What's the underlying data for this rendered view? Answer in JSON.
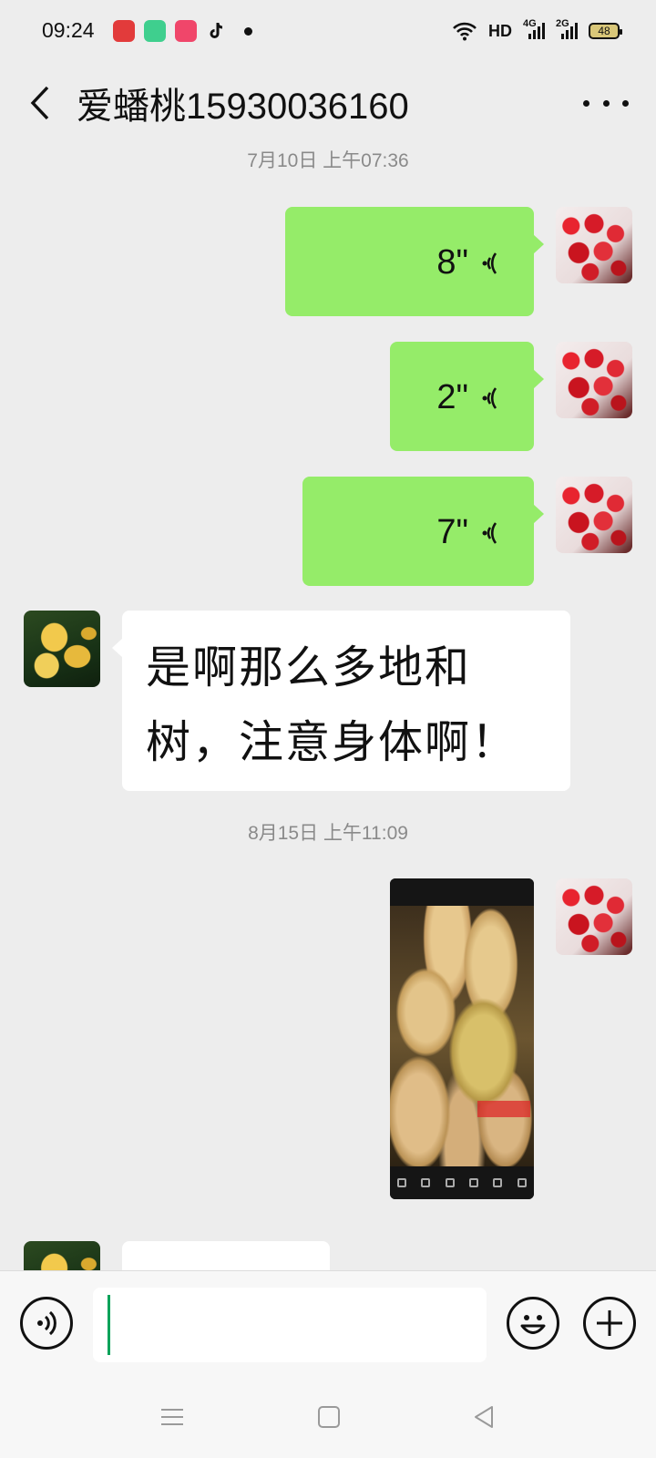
{
  "status_bar": {
    "time": "09:24",
    "hd_label": "HD",
    "net1_label": "4G",
    "net2_label": "2G",
    "battery": "48",
    "app_icons": [
      "red-heart-app-icon",
      "green-app-icon",
      "pink-play-app-icon",
      "tiktok-icon"
    ]
  },
  "header": {
    "title": "爱蟠桃15930036160"
  },
  "messages": {
    "timestamp_1": "7月10日 上午07:36",
    "voice_1": "8\"",
    "voice_2": "2\"",
    "voice_3": "7\"",
    "text_1": "是啊那么多地和树，注意身体啊！",
    "timestamp_2": "8月15日 上午11:09"
  },
  "colors": {
    "background": "#ededed",
    "my_bubble": "#95ec69",
    "peer_bubble": "#ffffff",
    "caret": "#07a35a"
  }
}
